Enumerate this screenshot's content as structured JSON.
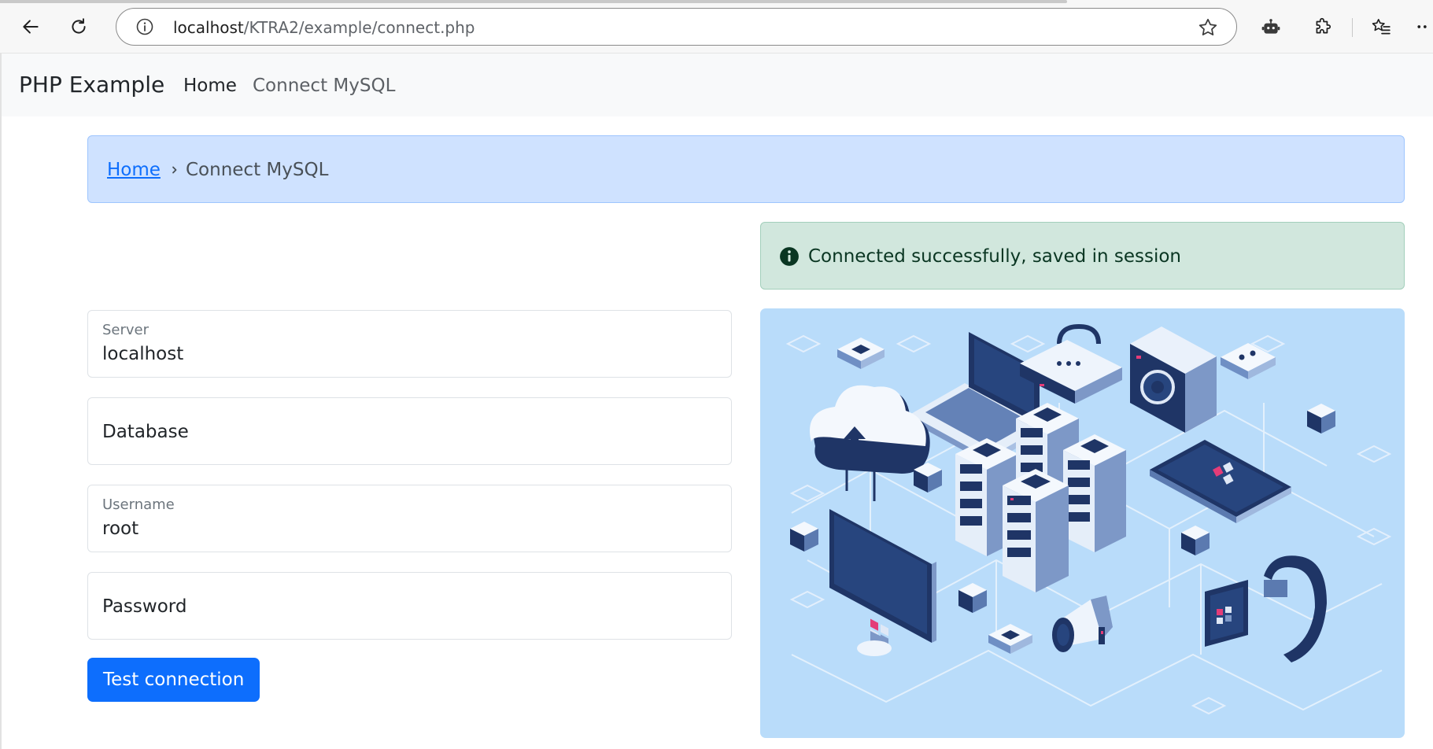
{
  "browser": {
    "url_host": "localhost",
    "url_path": "/KTRA2/example/connect.php",
    "icons": [
      "back-arrow-icon",
      "reload-icon",
      "site-info-icon",
      "favorite-star-icon",
      "copilot-icon",
      "extensions-icon",
      "favorites-icon",
      "more-icon"
    ]
  },
  "navbar": {
    "brand": "PHP Example",
    "links": [
      {
        "label": "Home"
      },
      {
        "label": "Connect MySQL"
      }
    ]
  },
  "breadcrumb": {
    "home": "Home",
    "current": "Connect MySQL"
  },
  "alert": {
    "message": "Connected successfully, saved in session"
  },
  "form": {
    "server": {
      "label": "Server",
      "value": "localhost"
    },
    "database": {
      "placeholder": "Database"
    },
    "username": {
      "label": "Username",
      "value": "root"
    },
    "password": {
      "placeholder": "Password"
    },
    "submit_label": "Test connection"
  },
  "colors": {
    "primary": "#0d6efd",
    "breadcrumb_bg": "#cfe2ff",
    "alert_bg": "#d1e7dd",
    "hero_bg": "#b9dcfa",
    "hero_navy": "#1f3566"
  }
}
